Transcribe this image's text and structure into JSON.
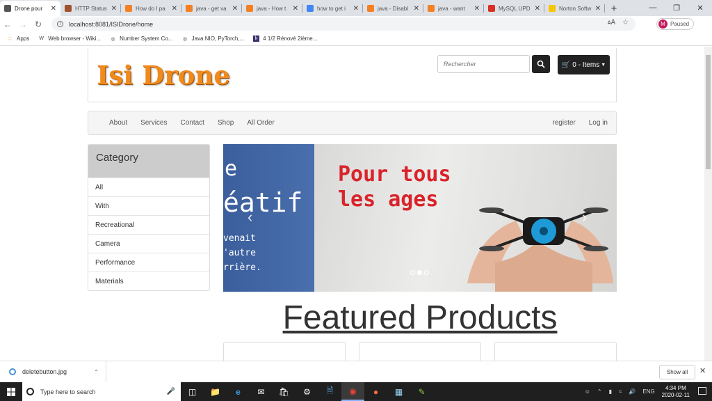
{
  "browser": {
    "tabs": [
      {
        "label": "Drone pour",
        "active": true,
        "icon": "globe-icon",
        "color": "#555555"
      },
      {
        "label": "HTTP Status",
        "active": false,
        "icon": "tomcat-icon",
        "color": "#a0522d"
      },
      {
        "label": "How do I pa",
        "active": false,
        "icon": "stackoverflow-icon",
        "color": "#f48024"
      },
      {
        "label": "java - get va",
        "active": false,
        "icon": "stackoverflow-icon",
        "color": "#f48024"
      },
      {
        "label": "java - How t",
        "active": false,
        "icon": "stackoverflow-icon",
        "color": "#f48024"
      },
      {
        "label": "how to get i",
        "active": false,
        "icon": "google-icon",
        "color": "#4285f4"
      },
      {
        "label": "java - Disabl",
        "active": false,
        "icon": "stackoverflow-icon",
        "color": "#f48024"
      },
      {
        "label": "java - want",
        "active": false,
        "icon": "stackoverflow-icon",
        "color": "#f48024"
      },
      {
        "label": "MySQL UPD",
        "active": false,
        "icon": "gmail-icon",
        "color": "#d93025"
      },
      {
        "label": "Norton Softw",
        "active": false,
        "icon": "norton-icon",
        "color": "#f6c700"
      }
    ],
    "url": "localhost:8081/ISIDrone/home",
    "profile_label": "Paused",
    "profile_initial": "M",
    "bookmarks": [
      {
        "label": "Apps",
        "icon": "apps-grid-icon"
      },
      {
        "label": "Web browser - Wiki...",
        "icon": "wikipedia-icon"
      },
      {
        "label": "Number System Co...",
        "icon": "globe-icon"
      },
      {
        "label": "Java NIO, PyTorch,...",
        "icon": "globe-icon"
      },
      {
        "label": "4 1/2 Rénové 2ième...",
        "icon": "kijiji-icon"
      }
    ]
  },
  "site": {
    "logo_text": "Isi Drone",
    "search_placeholder": "Rechercher",
    "cart_label": "0 - Items",
    "nav_left": [
      "About",
      "Services",
      "Contact",
      "Shop",
      "All Order"
    ],
    "nav_right": [
      "register",
      "Log in"
    ],
    "category_title": "Category",
    "categories": [
      "All",
      "With",
      "Recreational",
      "Camera",
      "Performance",
      "Materials"
    ],
    "carousel": {
      "left_text_1": "e",
      "left_text_2": "éatif",
      "left_text_3": "venait",
      "left_text_4": "'autre",
      "left_text_5": "rrière.",
      "slogan_1": "Pour tous",
      "slogan_2": "les ages",
      "active_slide": 2,
      "slide_count": 3
    },
    "featured_title": "Featured Products"
  },
  "downloads": {
    "file_name": "deletebutton.jpg",
    "show_all": "Show all"
  },
  "taskbar": {
    "search_placeholder": "Type here to search",
    "language": "ENG",
    "time": "4:34 PM",
    "date": "2020-02-11"
  }
}
